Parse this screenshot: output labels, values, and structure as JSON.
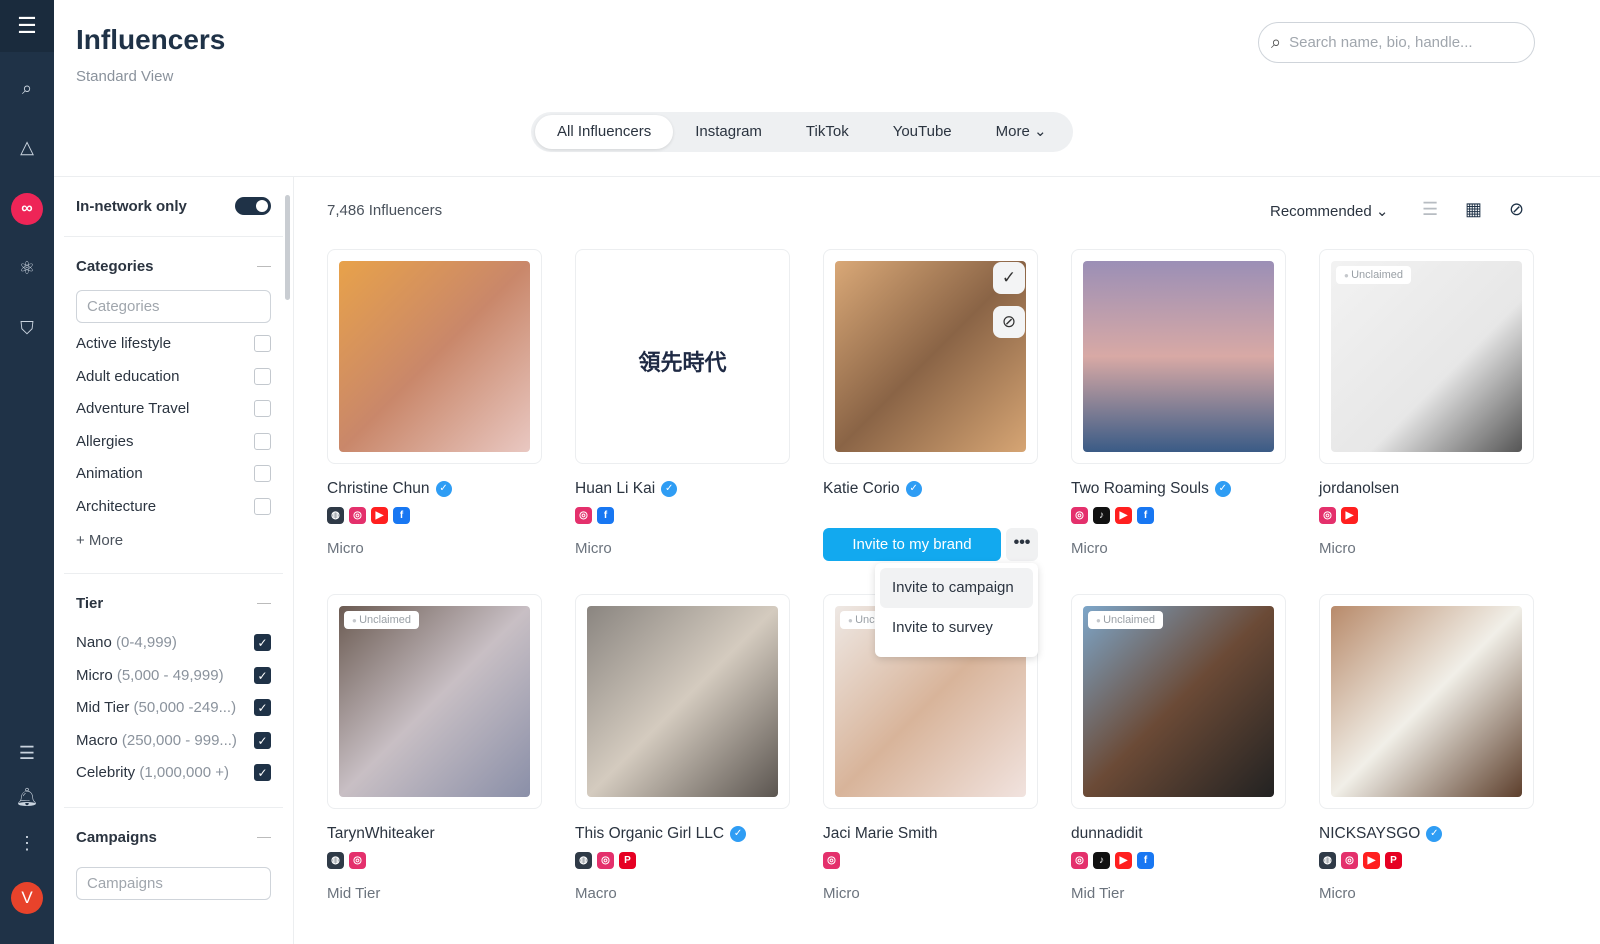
{
  "header": {
    "title": "Influencers",
    "subtitle": "Standard View",
    "search_placeholder": "Search name, bio, handle..."
  },
  "tabs": [
    "All Influencers",
    "Instagram",
    "TikTok",
    "YouTube",
    "More"
  ],
  "rail": {
    "avatar": "V",
    "icons": [
      "menu-icon",
      "search-icon",
      "network-icon",
      "infinity-icon",
      "atom-icon",
      "shield-icon",
      "checklist-icon",
      "bell-icon",
      "more-vertical-icon"
    ]
  },
  "filters": {
    "in_network_label": "In-network only",
    "in_network_on": true,
    "categories_title": "Categories",
    "categories_placeholder": "Categories",
    "categories": [
      "Active lifestyle",
      "Adult education",
      "Adventure Travel",
      "Allergies",
      "Animation",
      "Architecture"
    ],
    "more_label": "+ More",
    "tier_title": "Tier",
    "tiers": [
      {
        "name": "Nano",
        "range": "(0-4,999)"
      },
      {
        "name": "Micro",
        "range": "(5,000 - 49,999)"
      },
      {
        "name": "Mid Tier",
        "range": "(50,000 -249...)"
      },
      {
        "name": "Macro",
        "range": "(250,000 - 999...)"
      },
      {
        "name": "Celebrity",
        "range": "(1,000,000 +)"
      }
    ],
    "campaigns_title": "Campaigns",
    "campaigns_placeholder": "Campaigns"
  },
  "results": {
    "count": "7,486 Influencers",
    "sort": "Recommended"
  },
  "social_colors": {
    "web": "#2f3a47",
    "instagram": "#e4306c",
    "tiktok": "#111111",
    "youtube": "#ff1f1f",
    "facebook": "#1877f2",
    "pinterest": "#e60023"
  },
  "cards": [
    {
      "name": "Christine Chun",
      "verified": true,
      "socials": [
        "web",
        "instagram",
        "youtube",
        "facebook"
      ],
      "tier": "Micro",
      "unclaimed": false,
      "img": "linear-gradient(135deg,#e8a24a,#c9876a 50%,#e9c8c2)"
    },
    {
      "name": "Huan Li Kai",
      "verified": true,
      "socials": [
        "instagram",
        "facebook"
      ],
      "tier": "Micro",
      "unclaimed": false,
      "img": "#ffffff",
      "logo": "領先時代"
    },
    {
      "name": "Katie Corio",
      "verified": true,
      "socials": [],
      "tier": "",
      "unclaimed": false,
      "img": "linear-gradient(135deg,#d9a877,#8a6446 50%,#d6a574)"
    },
    {
      "name": "Two Roaming Souls",
      "verified": true,
      "socials": [
        "instagram",
        "tiktok",
        "youtube",
        "facebook"
      ],
      "tier": "Micro",
      "unclaimed": false,
      "img": "linear-gradient(180deg,#9b8fb6,#d8a9a5 50%,#3a5b86)"
    },
    {
      "name": "jordanolsen",
      "verified": false,
      "socials": [
        "instagram",
        "youtube"
      ],
      "tier": "Micro",
      "unclaimed": true,
      "img": "linear-gradient(135deg,#f2f2f2,#e7e7e7 60%,#555)"
    },
    {
      "name": "TarynWhiteaker",
      "verified": false,
      "socials": [
        "web",
        "instagram"
      ],
      "tier": "Mid Tier",
      "unclaimed": true,
      "img": "linear-gradient(135deg,#6b5b52,#c8bfc4 50%,#8a8fa8)"
    },
    {
      "name": "This Organic Girl LLC",
      "verified": true,
      "socials": [
        "web",
        "instagram",
        "pinterest"
      ],
      "tier": "Macro",
      "unclaimed": false,
      "img": "linear-gradient(135deg,#8a8580,#d4cbbf 50%,#5b5550)"
    },
    {
      "name": "Jaci Marie Smith",
      "verified": false,
      "socials": [
        "instagram"
      ],
      "tier": "Micro",
      "unclaimed": true,
      "img": "linear-gradient(135deg,#eee8e4,#d8b49a 50%,#f1e3df)"
    },
    {
      "name": "dunnadidit",
      "verified": false,
      "socials": [
        "instagram",
        "tiktok",
        "youtube",
        "facebook"
      ],
      "tier": "Mid Tier",
      "unclaimed": true,
      "img": "linear-gradient(135deg,#7da6c9,#6b4a36 50%,#222)"
    },
    {
      "name": "NICKSAYSGO",
      "verified": true,
      "socials": [
        "web",
        "instagram",
        "youtube",
        "pinterest"
      ],
      "tier": "Micro",
      "unclaimed": false,
      "img": "linear-gradient(135deg,#b88a6a,#f1efe8 50%,#5d3f2c)"
    }
  ],
  "unclaimed_label": "Unclaimed",
  "actions": {
    "invite_brand": "Invite to my brand",
    "menu": [
      "Invite to campaign",
      "Invite to survey"
    ]
  }
}
